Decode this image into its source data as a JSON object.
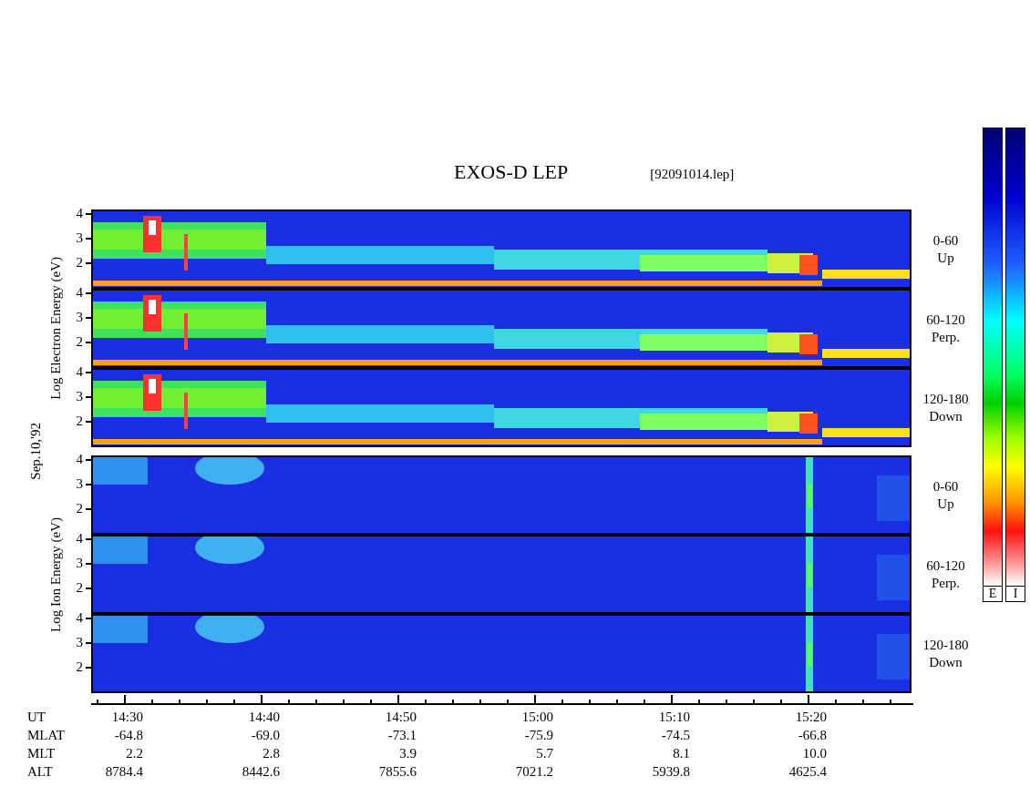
{
  "title": "EXOS-D LEP",
  "file": "[92091014.lep]",
  "date_label": "Sep.10,'92",
  "groups": [
    {
      "kind": "electron",
      "axis_label": "Log Electron Energy (eV)",
      "panels": [
        {
          "range": "0-60",
          "direction": "Up",
          "yticks": [
            "4",
            "3",
            "2"
          ]
        },
        {
          "range": "60-120",
          "direction": "Perp.",
          "yticks": [
            "4",
            "3",
            "2"
          ]
        },
        {
          "range": "120-180",
          "direction": "Down",
          "yticks": [
            "4",
            "3",
            "2"
          ]
        }
      ]
    },
    {
      "kind": "ion",
      "axis_label": "Log Ion Energy (eV)",
      "panels": [
        {
          "range": "0-60",
          "direction": "Up",
          "yticks": [
            "4",
            "3",
            "2"
          ]
        },
        {
          "range": "60-120",
          "direction": "Perp.",
          "yticks": [
            "4",
            "3",
            "2"
          ]
        },
        {
          "range": "120-180",
          "direction": "Down",
          "yticks": [
            "4",
            "3",
            "2"
          ]
        }
      ]
    }
  ],
  "colorbars": [
    {
      "label": "E"
    },
    {
      "label": "I"
    }
  ],
  "time_rows": [
    {
      "label": "UT",
      "values": [
        "14:30",
        "14:40",
        "14:50",
        "15:00",
        "15:10",
        "15:20"
      ]
    },
    {
      "label": "MLAT",
      "values": [
        "-64.8",
        "-69.0",
        "-73.1",
        "-75.9",
        "-74.5",
        "-66.8"
      ]
    },
    {
      "label": "MLT",
      "values": [
        "2.2",
        "2.8",
        "3.9",
        "5.7",
        "8.1",
        "10.0"
      ]
    },
    {
      "label": "ALT",
      "values": [
        "8784.4",
        "8442.6",
        "7855.6",
        "7021.2",
        "5939.8",
        "4625.4"
      ]
    }
  ]
}
